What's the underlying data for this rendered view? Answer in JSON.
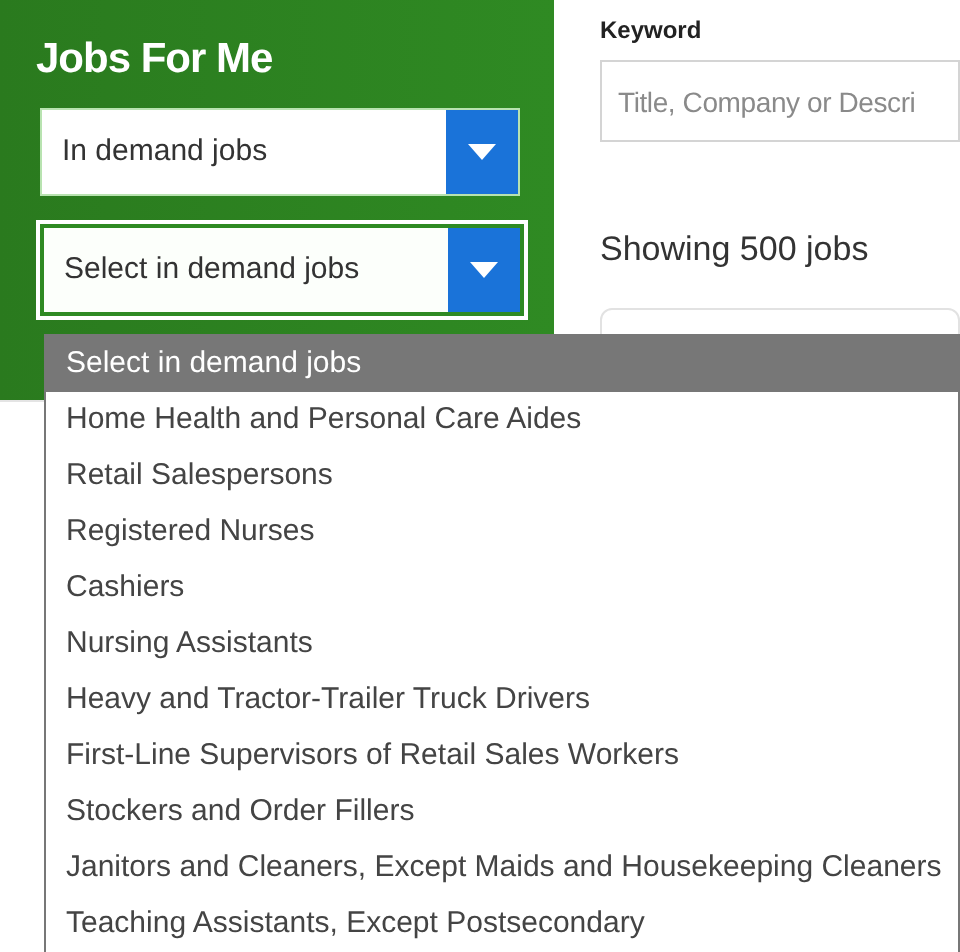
{
  "sidebar": {
    "title": "Jobs For Me",
    "selects": [
      {
        "value": "In demand jobs",
        "focused": false
      },
      {
        "value": "Select in demand jobs",
        "focused": true
      }
    ]
  },
  "search": {
    "label": "Keyword",
    "placeholder": "Title, Company or Descri"
  },
  "results": {
    "summary": "Showing 500 jobs"
  },
  "dropdown": {
    "options": [
      {
        "label": "Select in demand jobs",
        "selected": true
      },
      {
        "label": "Home Health and Personal Care Aides",
        "selected": false
      },
      {
        "label": "Retail Salespersons",
        "selected": false
      },
      {
        "label": "Registered Nurses",
        "selected": false
      },
      {
        "label": "Cashiers",
        "selected": false
      },
      {
        "label": "Nursing Assistants",
        "selected": false
      },
      {
        "label": "Heavy and Tractor-Trailer Truck Drivers",
        "selected": false
      },
      {
        "label": "First-Line Supervisors of Retail Sales Workers",
        "selected": false
      },
      {
        "label": "Stockers and Order Fillers",
        "selected": false
      },
      {
        "label": "Janitors and Cleaners, Except Maids and Housekeeping Cleaners",
        "selected": false
      },
      {
        "label": "Teaching Assistants, Except Postsecondary",
        "selected": false
      }
    ]
  }
}
